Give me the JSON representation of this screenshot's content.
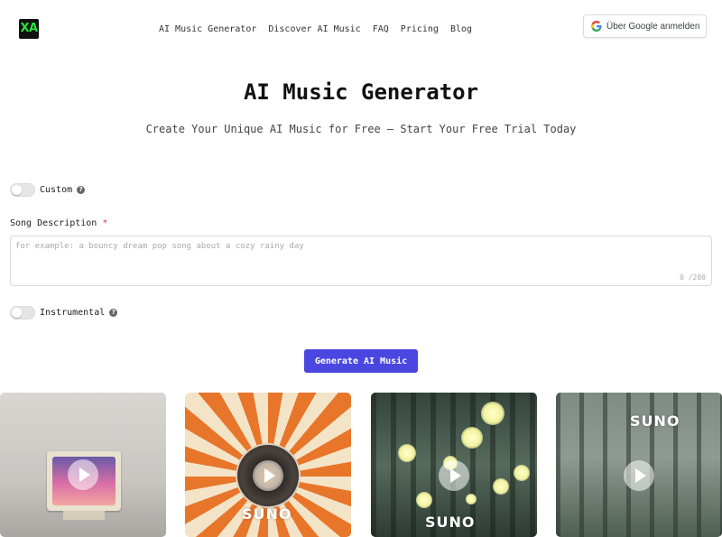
{
  "header": {
    "logo_text": "XA",
    "nav": [
      "AI Music Generator",
      "Discover AI Music",
      "FAQ",
      "Pricing",
      "Blog"
    ],
    "google_button": "Über Google anmelden"
  },
  "hero": {
    "title": "AI Music Generator",
    "subtitle": "Create Your Unique AI Music for Free – Start Your Free Trial Today"
  },
  "form": {
    "custom_label": "Custom",
    "song_description_label": "Song Description",
    "required_mark": "*",
    "placeholder": "for example: a bouncy dream pop song about a cozy rainy day",
    "value": "",
    "counter": "0 /200",
    "instrumental_label": "Instrumental",
    "generate_button": "Generate AI Music"
  },
  "cards": [
    {
      "icon": "play-icon",
      "watermark": ""
    },
    {
      "icon": "play-icon",
      "watermark": "SUNO"
    },
    {
      "icon": "play-icon",
      "watermark": "SUNO"
    },
    {
      "icon": "play-icon",
      "watermark": "SUNO"
    }
  ],
  "colors": {
    "accent": "#4a46e0",
    "logo_bg": "#111111",
    "logo_fg": "#27e33b",
    "required": "#e03b3b"
  }
}
